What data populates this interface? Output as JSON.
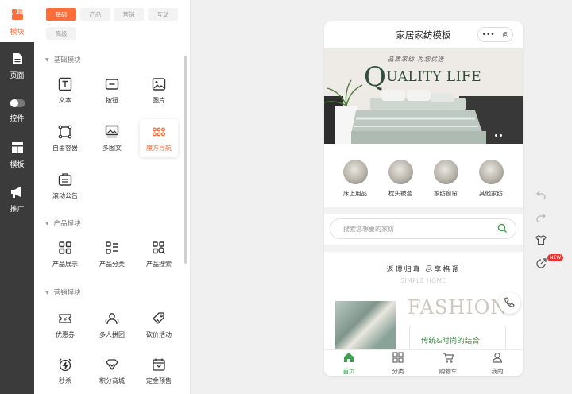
{
  "rail": {
    "top": {
      "label": "模块",
      "icon": "module-icon",
      "color": "#ff6d3a"
    },
    "items": [
      {
        "label": "页面",
        "icon": "page-icon"
      },
      {
        "label": "控件",
        "icon": "toggle-icon"
      },
      {
        "label": "模板",
        "icon": "template-icon"
      },
      {
        "label": "推广",
        "icon": "megaphone-icon"
      }
    ]
  },
  "panel": {
    "tabs": [
      "基础",
      "产品",
      "营销",
      "互动",
      "高级"
    ],
    "active_tab": "基础",
    "sections": [
      {
        "title": "基础模块",
        "items": [
          {
            "label": "文本",
            "icon": "text-icon"
          },
          {
            "label": "按钮",
            "icon": "button-icon"
          },
          {
            "label": "图片",
            "icon": "image-icon"
          },
          {
            "label": "自由容器",
            "icon": "container-icon"
          },
          {
            "label": "多图文",
            "icon": "multi-image-icon"
          },
          {
            "label": "魔方导航",
            "icon": "grid-dots-icon",
            "active": true
          },
          {
            "label": "滚动公告",
            "icon": "notice-icon"
          }
        ]
      },
      {
        "title": "产品模块",
        "items": [
          {
            "label": "产品展示",
            "icon": "product-grid-icon"
          },
          {
            "label": "产品分类",
            "icon": "category-list-icon"
          },
          {
            "label": "产品搜索",
            "icon": "product-search-icon"
          }
        ]
      },
      {
        "title": "营销模块",
        "items": [
          {
            "label": "优惠券",
            "icon": "coupon-icon"
          },
          {
            "label": "多人拼团",
            "icon": "group-buy-icon"
          },
          {
            "label": "砍价活动",
            "icon": "bargain-icon"
          },
          {
            "label": "秒杀",
            "icon": "flash-sale-icon"
          },
          {
            "label": "积分商城",
            "icon": "points-mall-icon"
          },
          {
            "label": "定金预售",
            "icon": "presale-icon"
          }
        ]
      }
    ]
  },
  "preview": {
    "title": "家居家纺模板",
    "capsule": {
      "more": "•••",
      "close": "◎"
    },
    "banner": {
      "subtitle": "品质家纺   为您优选",
      "title_initial": "Q",
      "title_rest": "UALITY LIFE"
    },
    "categories": [
      "床上用品",
      "枕头被套",
      "家纺窗帘",
      "其他家纺"
    ],
    "search_placeholder": "搜索您想要的家纺",
    "slogan": "返璞归真  尽享格调",
    "slogan_en": "SIMPLE HOME",
    "fashion_word": "FASHION",
    "fashion_caption": "传统&时尚的结合",
    "tabbar": [
      {
        "label": "首页",
        "icon": "home-icon",
        "active": true
      },
      {
        "label": "分类",
        "icon": "category-icon"
      },
      {
        "label": "购物车",
        "icon": "cart-icon"
      },
      {
        "label": "我的",
        "icon": "user-icon"
      }
    ],
    "accent": "#3aa24a"
  },
  "side_tools": {
    "badge": "NEW",
    "items": [
      "undo-icon",
      "redo-icon",
      "shirt-icon",
      "share-icon"
    ]
  }
}
